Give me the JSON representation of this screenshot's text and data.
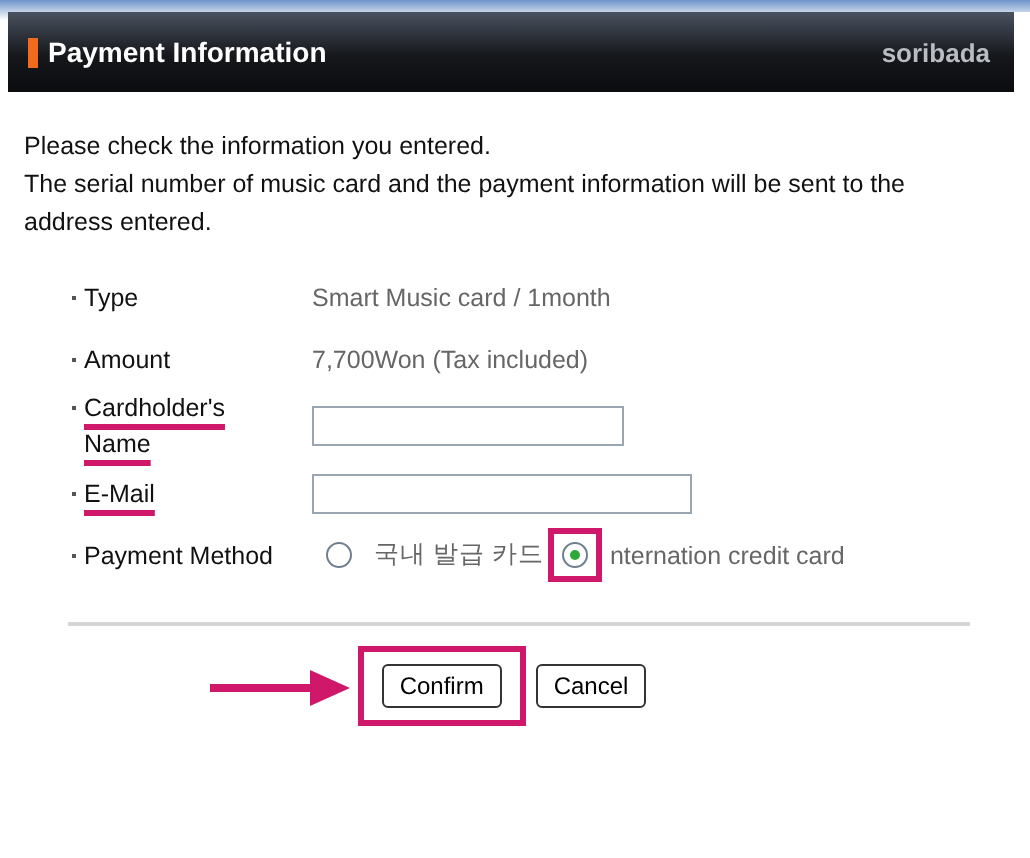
{
  "header": {
    "title": "Payment Information",
    "brand": "soribada"
  },
  "intro": [
    "Please check the information you entered.",
    "The serial number of music card and the payment information will be sent to the address entered."
  ],
  "rows": [
    {
      "kind": "text",
      "label": "Type",
      "value": "Smart Music card / 1month",
      "annotated": false
    },
    {
      "kind": "text",
      "label": "Amount",
      "value": "7,700Won (Tax included)",
      "annotated": false
    },
    {
      "kind": "input",
      "label": "Cardholder's Name",
      "annotated": true
    },
    {
      "kind": "email",
      "label": "E-Mail",
      "annotated": true
    },
    {
      "kind": "radio",
      "label": "Payment Method",
      "annotated": false,
      "options": [
        {
          "label": "국내 발급 카드",
          "selected": false,
          "annotated": false
        },
        {
          "label": "nternation credit card",
          "selected": true,
          "annotated": true
        }
      ]
    }
  ],
  "buttons": [
    {
      "label": "Confirm",
      "annotated": true
    },
    {
      "label": "Cancel",
      "annotated": false
    }
  ]
}
